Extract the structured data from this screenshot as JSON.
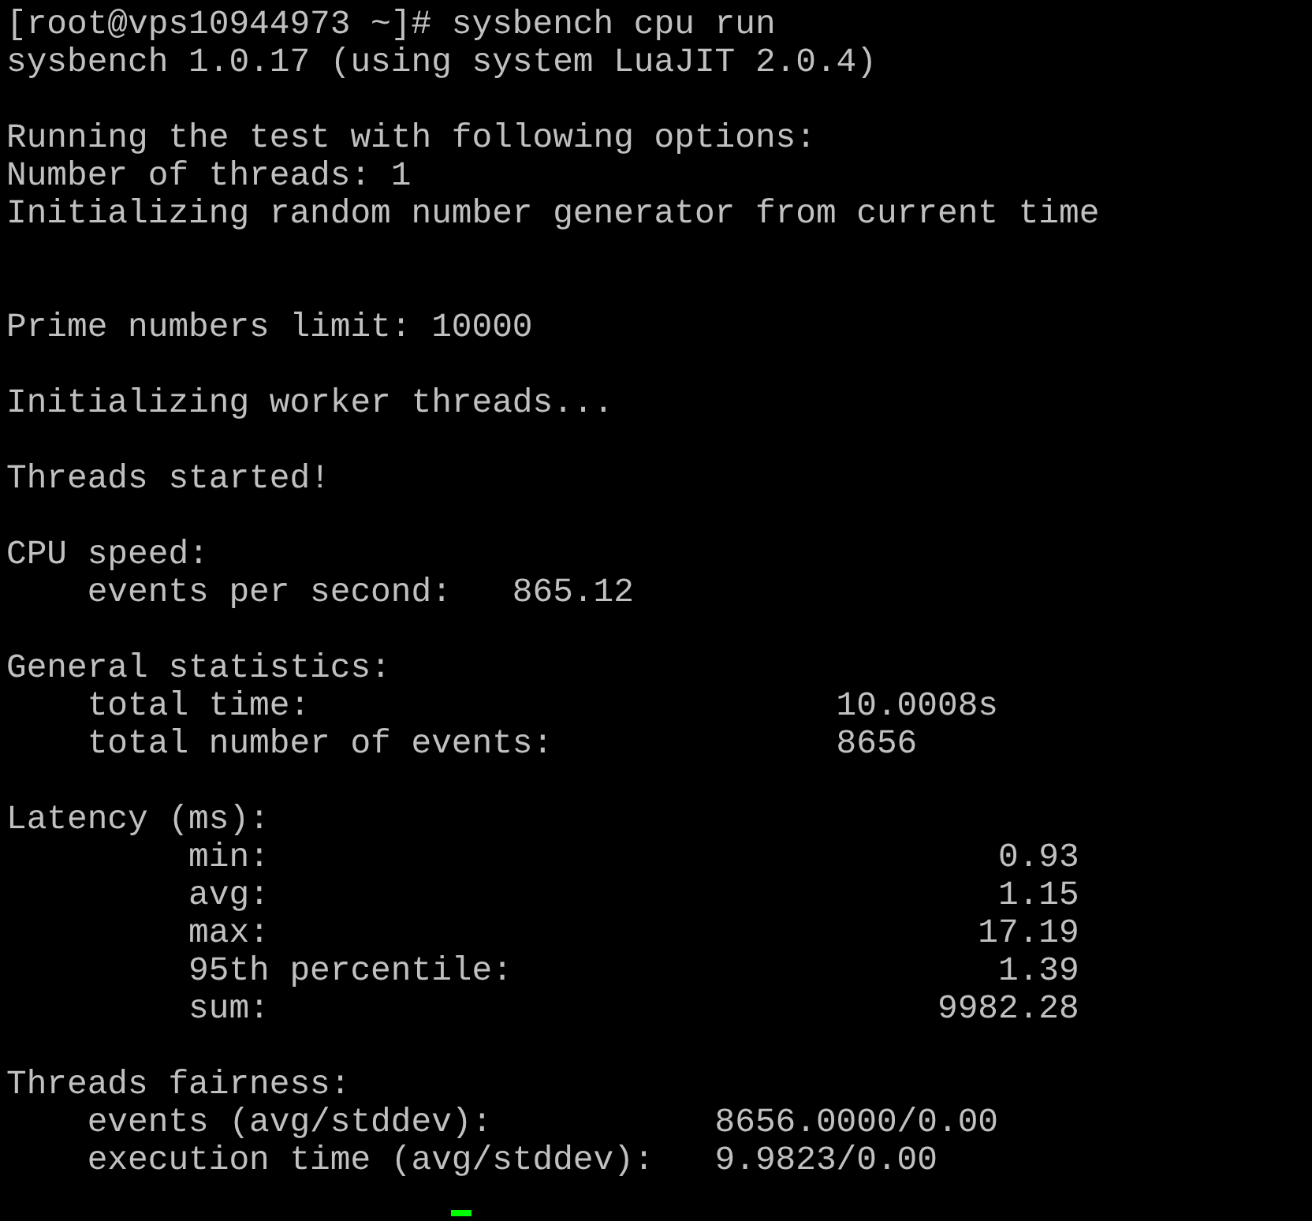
{
  "terminal": {
    "lines": [
      {
        "kind": "text",
        "text": "[root@vps10944973 ~]# sysbench cpu run"
      },
      {
        "kind": "text",
        "text": "sysbench 1.0.17 (using system LuaJIT 2.0.4)"
      },
      {
        "kind": "blank"
      },
      {
        "kind": "text",
        "text": "Running the test with following options:"
      },
      {
        "kind": "text",
        "text": "Number of threads: 1"
      },
      {
        "kind": "text",
        "text": "Initializing random number generator from current time"
      },
      {
        "kind": "blank"
      },
      {
        "kind": "blank"
      },
      {
        "kind": "text",
        "text": "Prime numbers limit: 10000"
      },
      {
        "kind": "blank"
      },
      {
        "kind": "text",
        "text": "Initializing worker threads..."
      },
      {
        "kind": "blank"
      },
      {
        "kind": "text",
        "text": "Threads started!"
      },
      {
        "kind": "blank"
      },
      {
        "kind": "text",
        "text": "CPU speed:"
      },
      {
        "kind": "text",
        "text": "    events per second:   865.12"
      },
      {
        "kind": "blank"
      },
      {
        "kind": "text",
        "text": "General statistics:"
      },
      {
        "kind": "text",
        "text": "    total time:                          10.0008s"
      },
      {
        "kind": "text",
        "text": "    total number of events:              8656"
      },
      {
        "kind": "blank"
      },
      {
        "kind": "text",
        "text": "Latency (ms):"
      },
      {
        "kind": "text",
        "text": "         min:                                    0.93"
      },
      {
        "kind": "text",
        "text": "         avg:                                    1.15"
      },
      {
        "kind": "text",
        "text": "         max:                                   17.19"
      },
      {
        "kind": "text",
        "text": "         95th percentile:                        1.39"
      },
      {
        "kind": "text",
        "text": "         sum:                                 9982.28"
      },
      {
        "kind": "blank"
      },
      {
        "kind": "text",
        "text": "Threads fairness:"
      },
      {
        "kind": "text",
        "text": "    events (avg/stddev):           8656.0000/0.00"
      },
      {
        "kind": "text",
        "text": "    execution time (avg/stddev):   9.9823/0.00"
      },
      {
        "kind": "cursor"
      }
    ]
  }
}
